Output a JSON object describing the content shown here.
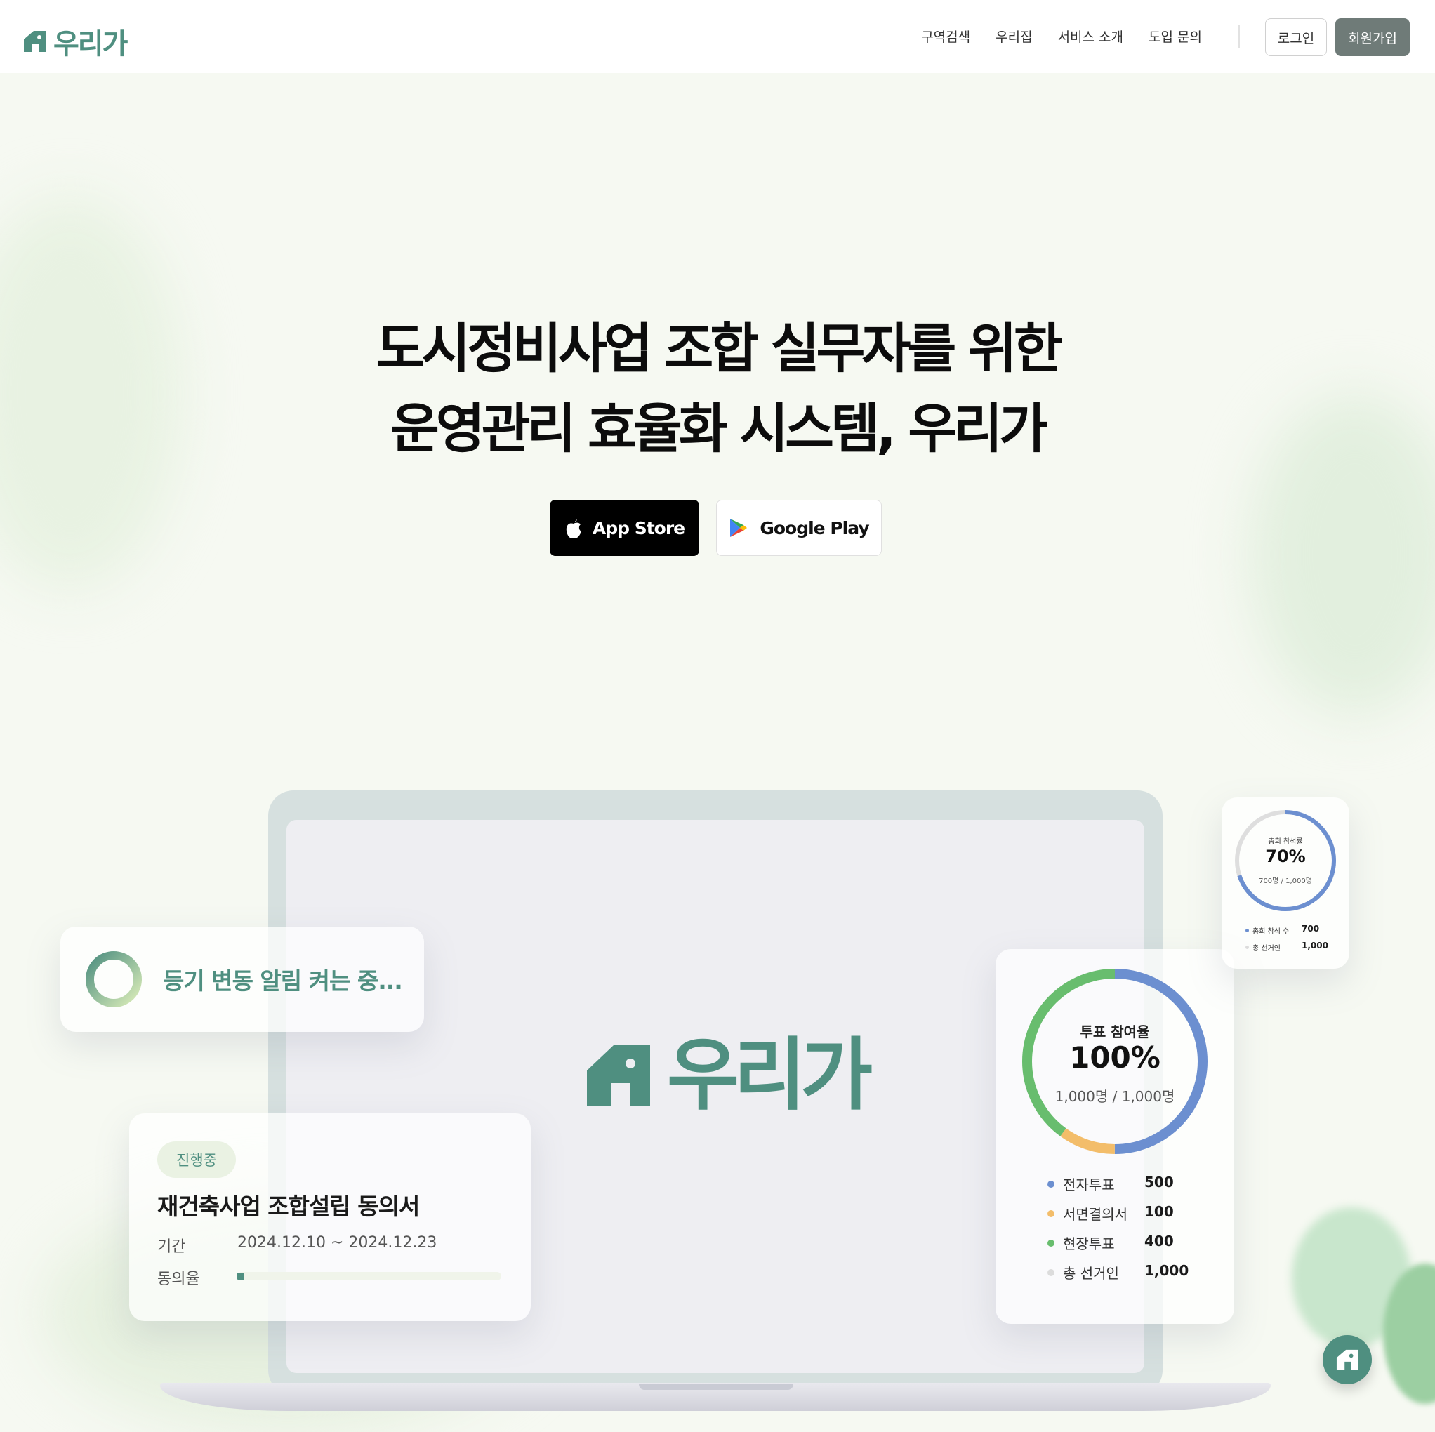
{
  "brand": {
    "name": "우리가",
    "color": "#4f8f80"
  },
  "nav": {
    "items": [
      "구역검색",
      "우리집",
      "서비스 소개",
      "도입 문의"
    ],
    "login": "로그인",
    "signup": "회원가입"
  },
  "hero": {
    "line1": "도시정비사업 조합 실무자를 위한",
    "line2": "운영관리 효율화 시스템, 우리가",
    "app_store": "App Store",
    "google_play": "Google Play"
  },
  "registry_card": {
    "text": "등기 변동 알림 켜는 중..."
  },
  "consent_card": {
    "status": "진행중",
    "title": "재건축사업 조합설립 동의서",
    "period_label": "기간",
    "period_value": "2024.12.10 ~ 2024.12.23",
    "rate_label": "동의율",
    "rate_fraction": 0.02
  },
  "vote_card": {
    "title": "투표 참여율",
    "percent": "100%",
    "count": "1,000명 / 1,000명",
    "legend": [
      {
        "label": "전자투표",
        "value": "500",
        "color": "#6c8fd0"
      },
      {
        "label": "서면결의서",
        "value": "100",
        "color": "#f3bd6a"
      },
      {
        "label": "현장투표",
        "value": "400",
        "color": "#68bd6e"
      },
      {
        "label": "총 선거인",
        "value": "1,000",
        "color": "#dcdcdc"
      }
    ]
  },
  "meeting_card": {
    "title": "총회 참석률",
    "percent": "70%",
    "count": "700명 / 1,000명",
    "legend": [
      {
        "label": "총회 참석 수",
        "value": "700",
        "color": "#6c8fd0"
      },
      {
        "label": "총 선거인",
        "value": "1,000",
        "color": "#dcdcdc"
      }
    ]
  },
  "icons": {
    "apple": "apple-icon",
    "google_play": "google-play-icon",
    "house": "house-icon",
    "chat": "house-chat-icon"
  }
}
